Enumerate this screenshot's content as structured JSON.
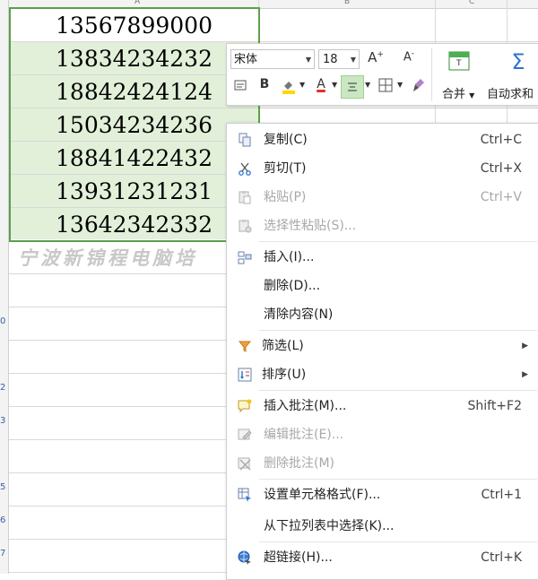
{
  "columns": [
    "A",
    "B",
    "C"
  ],
  "rows": [
    "0",
    "2",
    "3",
    "5",
    "6",
    "7"
  ],
  "cells": [
    "13567899000",
    "13834234232",
    "18842424124",
    "15034234236",
    "18841422432",
    "13931231231",
    "13642342332"
  ],
  "watermark": "宁波新锦程电脑培",
  "toolbar": {
    "font_name": "宋体",
    "font_size": "18",
    "grow_font": "A",
    "shrink_font": "A",
    "bold": "B",
    "font_color": "A",
    "merge_label": "合并",
    "autosum_label": "自动求和"
  },
  "menu": [
    {
      "label": "复制(C)",
      "shortcut": "Ctrl+C",
      "icon": "copy-icon",
      "disabled": false
    },
    {
      "label": "剪切(T)",
      "shortcut": "Ctrl+X",
      "icon": "scissors-icon",
      "disabled": false
    },
    {
      "label": "粘贴(P)",
      "shortcut": "Ctrl+V",
      "icon": "paste-icon",
      "disabled": true
    },
    {
      "label": "选择性粘贴(S)...",
      "shortcut": "",
      "icon": "paste-special-icon",
      "disabled": true
    },
    {
      "label": "插入(I)...",
      "shortcut": "",
      "icon": "insert-icon",
      "disabled": false
    },
    {
      "label": "删除(D)...",
      "shortcut": "",
      "icon": "",
      "disabled": false
    },
    {
      "label": "清除内容(N)",
      "shortcut": "",
      "icon": "",
      "disabled": false
    },
    {
      "label": "筛选(L)",
      "shortcut": "",
      "icon": "filter-icon",
      "disabled": false,
      "submenu": true
    },
    {
      "label": "排序(U)",
      "shortcut": "",
      "icon": "sort-icon",
      "disabled": false,
      "submenu": true
    },
    {
      "label": "插入批注(M)...",
      "shortcut": "Shift+F2",
      "icon": "insert-comment-icon",
      "disabled": false
    },
    {
      "label": "编辑批注(E)...",
      "shortcut": "",
      "icon": "edit-comment-icon",
      "disabled": true
    },
    {
      "label": "删除批注(M)",
      "shortcut": "",
      "icon": "delete-comment-icon",
      "disabled": true
    },
    {
      "label": "设置单元格格式(F)...",
      "shortcut": "Ctrl+1",
      "icon": "format-cells-icon",
      "disabled": false
    },
    {
      "label": "从下拉列表中选择(K)...",
      "shortcut": "",
      "icon": "",
      "disabled": false
    },
    {
      "label": "超链接(H)...",
      "shortcut": "Ctrl+K",
      "icon": "hyperlink-icon",
      "disabled": false
    }
  ],
  "colors": {
    "selection_fill": "#e2f0d9",
    "selection_border": "#5aa04b",
    "gridline": "#d9d9d9",
    "accent_blue": "#2e75d0",
    "highlight_yellow": "#ffd700",
    "font_color_red": "#e03030"
  }
}
